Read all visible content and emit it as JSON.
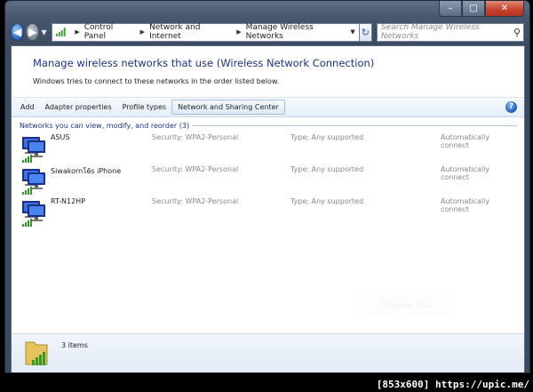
{
  "window": {
    "caption_buttons": {
      "minimize": "–",
      "maximize": "□",
      "close": "✕"
    }
  },
  "nav": {
    "back_icon": "back-arrow-icon",
    "forward_icon": "forward-arrow-icon",
    "breadcrumbs": [
      "Control Panel",
      "Network and Internet",
      "Manage Wireless Networks"
    ],
    "search_placeholder": "Search Manage Wireless Networks"
  },
  "page": {
    "title": "Manage wireless networks that use (Wireless Network Connection)",
    "subtitle": "Windows tries to connect to these networks in the order listed below."
  },
  "toolbar": {
    "items": [
      "Add",
      "Adapter properties",
      "Profile types",
      "Network and Sharing Center"
    ]
  },
  "group": {
    "title": "Networks you can view, modify, and reorder (3)"
  },
  "networks": [
    {
      "name": "ASUS",
      "security": "Security:  WPA2-Personal",
      "type": "Type:  Any supported",
      "mode": "Automatically connect"
    },
    {
      "name": "Siwakornโẽs iPhone",
      "security": "Security:  WPA2-Personal",
      "type": "Type:  Any supported",
      "mode": "Automatically connect"
    },
    {
      "name": "RT-N12HP",
      "security": "Security:  WPA2-Personal",
      "type": "Type:  Any supported",
      "mode": "Automatically connect"
    }
  ],
  "ghost_text": "Windows Snip",
  "details": {
    "count": "3 items"
  },
  "watermark": "[853x600] https://upic.me/",
  "colors": {
    "accent": "#1e3287",
    "chrome": "#46566d"
  }
}
